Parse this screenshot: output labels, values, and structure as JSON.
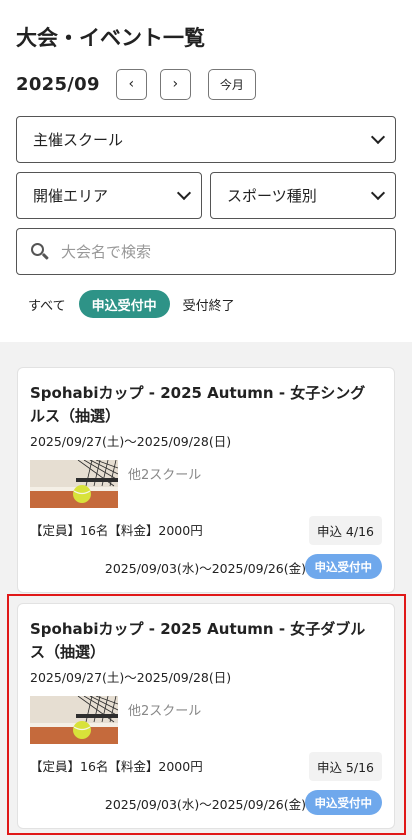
{
  "page": {
    "title": "大会・イベント一覧"
  },
  "month_nav": {
    "month": "2025/09",
    "prev_icon": "‹",
    "next_icon": "›",
    "today_label": "今月"
  },
  "filters": {
    "organizer": "主催スクール",
    "area": "開催エリア",
    "sport": "スポーツ種別"
  },
  "search": {
    "placeholder": "大会名で検索",
    "value": ""
  },
  "status_tabs": [
    {
      "label": "すべて",
      "active": false
    },
    {
      "label": "申込受付中",
      "active": true
    },
    {
      "label": "受付終了",
      "active": false
    }
  ],
  "events": [
    {
      "title": "Spohabiカップ - 2025 Autumn - 女子シングルス（抽選）",
      "dates": "2025/09/27(土)〜2025/09/28(日)",
      "schools": "他2スクール",
      "capacity": "【定員】16名【料金】2000円",
      "apply_count": "申込 4/16",
      "apply_period": "2025/09/03(水)〜2025/09/26(金)",
      "status": "申込受付中"
    },
    {
      "title": "Spohabiカップ - 2025 Autumn - 女子ダブルス（抽選）",
      "dates": "2025/09/27(土)〜2025/09/28(日)",
      "schools": "他2スクール",
      "capacity": "【定員】16名【料金】2000円",
      "apply_count": "申込 5/16",
      "apply_period": "2025/09/03(水)〜2025/09/26(金)",
      "status": "申込受付中"
    }
  ],
  "colors": {
    "accent": "#2e9387",
    "badge": "#6fa8ec",
    "highlight": "#e01818"
  }
}
